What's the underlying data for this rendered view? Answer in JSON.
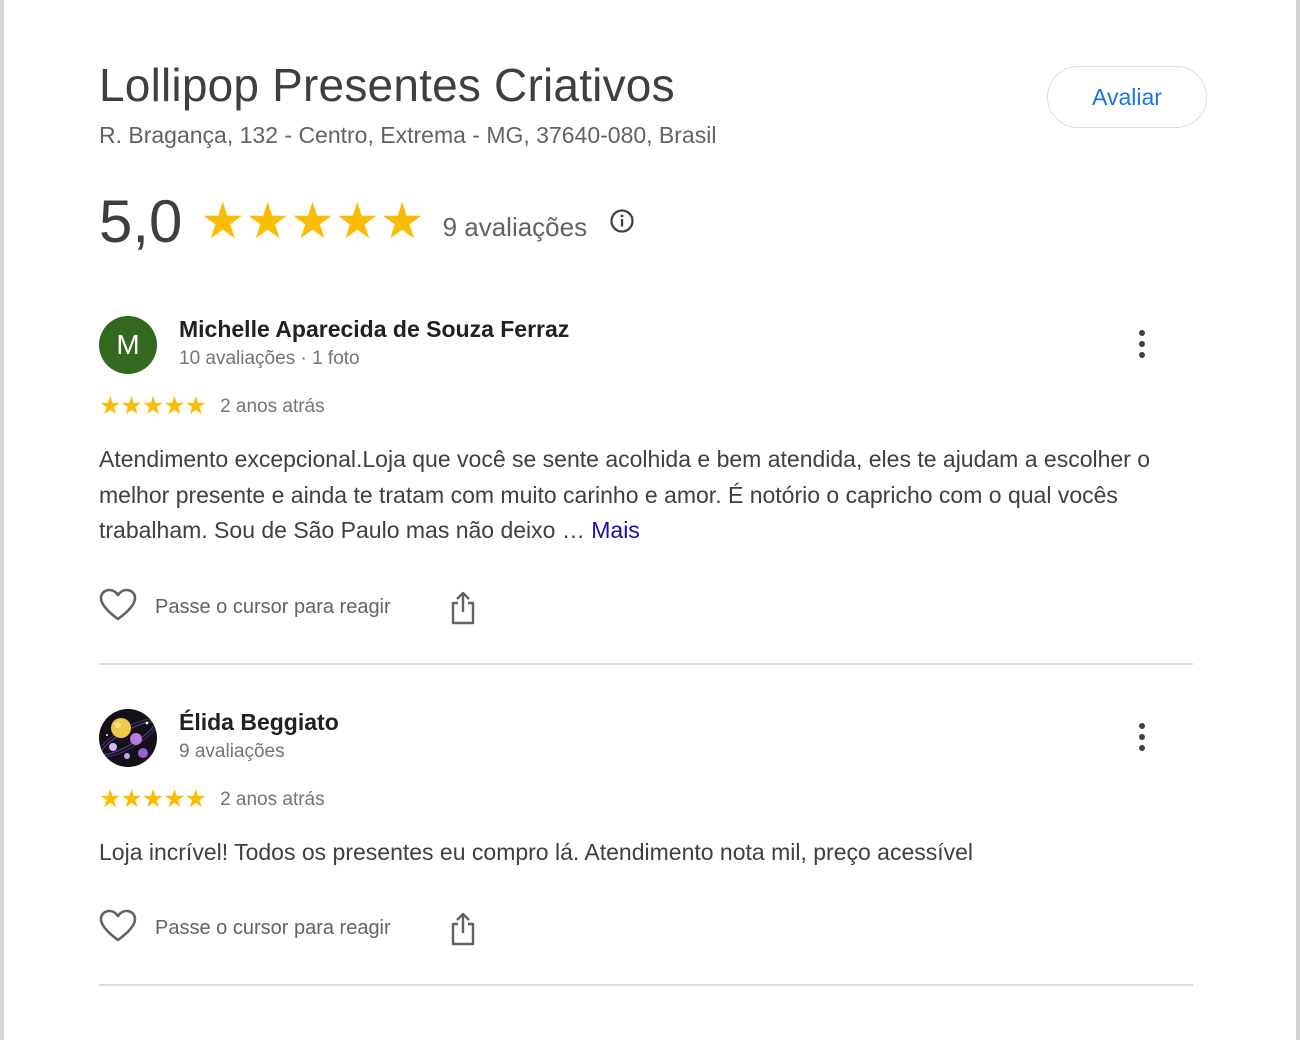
{
  "place": {
    "name": "Lollipop Presentes Criativos",
    "address": "R. Bragança, 132 - Centro, Extrema - MG, 37640-080, Brasil",
    "rate_button": "Avaliar",
    "rating": "5,0",
    "stars": 5,
    "review_count": "9 avaliações"
  },
  "reviews": [
    {
      "avatar_letter": "M",
      "avatar_color": "#33691e",
      "name": "Michelle Aparecida de Souza Ferraz",
      "meta": "10 avaliações · 1 foto",
      "stars": "★★★★★",
      "time": "2 anos atrás",
      "text": "Atendimento excepcional.Loja que você se sente acolhida e bem atendida, eles te ajudam a escolher o melhor presente e ainda te tratam com muito carinho e amor. É notório o capricho com o qual vocês trabalham. Sou de São Paulo mas não deixo …",
      "more": "Mais",
      "react_label": "Passe o cursor para reagir"
    },
    {
      "avatar_image": "planets-avatar",
      "name": "Élida Beggiato",
      "meta": "9 avaliações",
      "stars": "★★★★★",
      "time": "2 anos atrás",
      "text": "Loja incrível! Todos os presentes eu compro lá. Atendimento nota mil, preço acessível",
      "react_label": "Passe o cursor para reagir"
    }
  ],
  "colors": {
    "star": "#fbbc04",
    "accent_blue": "#1a73e8",
    "link": "#1a0dab"
  },
  "icons": [
    "info-icon",
    "more-vert-icon",
    "heart-icon",
    "share-icon"
  ]
}
